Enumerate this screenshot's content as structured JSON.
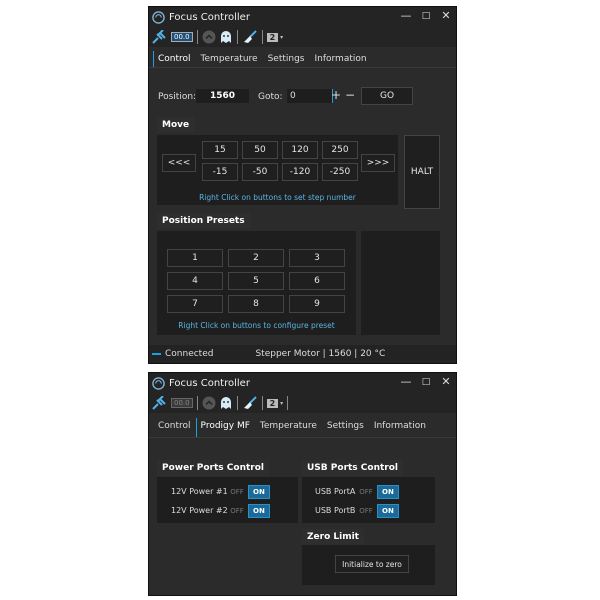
{
  "app": {
    "title": "Focus Controller",
    "minimize": "—",
    "maximize": "□",
    "close": "✕"
  },
  "toolbar": {
    "counter_value": "2",
    "display_text": "00.0"
  },
  "window1": {
    "tabs": [
      "Control",
      "Temperature",
      "Settings",
      "Information"
    ],
    "position_label": "Position:",
    "position_value": "1560",
    "goto_label": "Goto:",
    "goto_value": "0",
    "plus": "+",
    "minus": "−",
    "go_label": "GO",
    "move": {
      "title": "Move",
      "left_label": "<<<",
      "right_label": ">>>",
      "halt_label": "HALT",
      "steps_pos": [
        "15",
        "50",
        "120",
        "250"
      ],
      "steps_neg": [
        "-15",
        "-50",
        "-120",
        "-250"
      ],
      "hint": "Right Click on buttons to set step number"
    },
    "presets": {
      "title": "Position Presets",
      "buttons": [
        "1",
        "2",
        "3",
        "4",
        "5",
        "6",
        "7",
        "8",
        "9"
      ],
      "hint": "Right Click on buttons to configure preset"
    },
    "status": {
      "connection": "Connected",
      "info": "Stepper Motor | 1560 | 20 °C"
    }
  },
  "window2": {
    "tabs": [
      "Control",
      "Prodigy MF",
      "Temperature",
      "Settings",
      "Information"
    ],
    "power": {
      "title": "Power Ports Control",
      "ports": [
        {
          "label": "12V Power #1",
          "off": "OFF",
          "on": "ON"
        },
        {
          "label": "12V Power #2",
          "off": "OFF",
          "on": "ON"
        }
      ]
    },
    "usb": {
      "title": "USB Ports Control",
      "ports": [
        {
          "label": "USB PortA",
          "off": "OFF",
          "on": "ON"
        },
        {
          "label": "USB PortB",
          "off": "OFF",
          "on": "ON"
        }
      ]
    },
    "zero": {
      "title": "Zero Limit",
      "button": "Initialize to zero"
    }
  },
  "colors": {
    "accent": "#1ba1e2",
    "hint": "#5ab4e6",
    "toggle_on": "#1a6a9a"
  }
}
